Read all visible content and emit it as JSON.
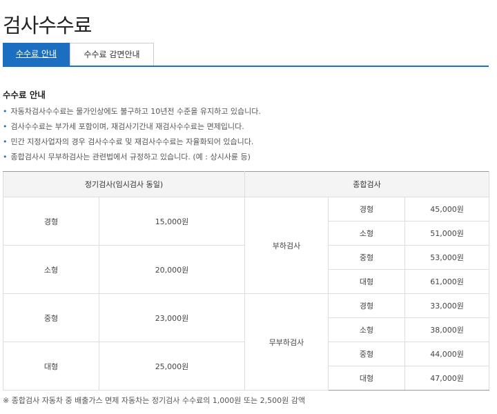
{
  "page": {
    "title": "검사수수료"
  },
  "tabs": [
    {
      "label": "수수료 안내",
      "active": true
    },
    {
      "label": "수수료 감면안내",
      "active": false
    }
  ],
  "section": {
    "title": "수수료 안내",
    "notes": [
      "자동차검사수수료는 물가인상에도 불구하고 10년전 수준을 유지하고 있습니다.",
      "검사수수료는 부가세 포함이며, 재검사기간내 재검사수수료는 면제입니다.",
      "민간 지정사업자의 경우 검사수수료 및 재검사수수료는 자율화되어 있습니다.",
      "종합검사시 무부하검사는 관련법에서 규정하고 있습니다. (예 : 상시사륜 등)"
    ]
  },
  "table": {
    "headers": {
      "regular": "정기검사(임시검사 동일)",
      "comprehensive": "종합검사"
    },
    "regular_rows": [
      {
        "size": "경형",
        "fee": "15,000원"
      },
      {
        "size": "소형",
        "fee": "20,000원"
      },
      {
        "size": "중형",
        "fee": "23,000원"
      },
      {
        "size": "대형",
        "fee": "25,000원"
      }
    ],
    "groups": [
      {
        "name": "부하검사",
        "rows": [
          {
            "size": "경형",
            "fee": "45,000원"
          },
          {
            "size": "소형",
            "fee": "51,000원"
          },
          {
            "size": "중형",
            "fee": "53,000원"
          },
          {
            "size": "대형",
            "fee": "61,000원"
          }
        ]
      },
      {
        "name": "무부하검사",
        "rows": [
          {
            "size": "경형",
            "fee": "33,000원"
          },
          {
            "size": "소형",
            "fee": "38,000원"
          },
          {
            "size": "중형",
            "fee": "44,000원"
          },
          {
            "size": "대형",
            "fee": "47,000원"
          }
        ]
      }
    ]
  },
  "footnote": "※ 종합검사 자동차 중 배출가스 면제 자동차는 정기검사 수수료의 1,000원 또는 2,500원 감액"
}
